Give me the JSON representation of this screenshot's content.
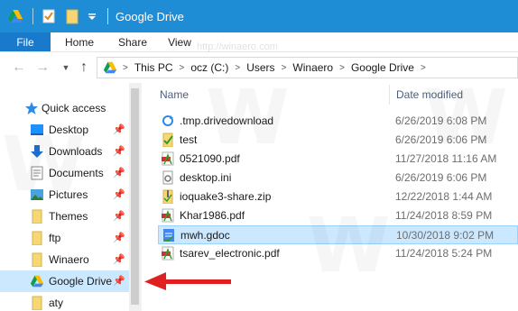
{
  "window": {
    "title": "Google Drive"
  },
  "ribbon": {
    "tabs": [
      "File",
      "Home",
      "Share",
      "View"
    ]
  },
  "address": {
    "crumbs": [
      "This PC",
      "ocz (C:)",
      "Users",
      "Winaero",
      "Google Drive"
    ],
    "watermark": "http://winaero.com"
  },
  "sidebar": {
    "items": [
      {
        "label": "Quick access",
        "icon": "star-icon",
        "pinned": false
      },
      {
        "label": "Desktop",
        "icon": "desktop-icon",
        "pinned": true
      },
      {
        "label": "Downloads",
        "icon": "download-arrow-icon",
        "pinned": true
      },
      {
        "label": "Documents",
        "icon": "documents-icon",
        "pinned": true
      },
      {
        "label": "Pictures",
        "icon": "pictures-icon",
        "pinned": true
      },
      {
        "label": "Themes",
        "icon": "folder-icon",
        "pinned": true
      },
      {
        "label": "ftp",
        "icon": "folder-icon",
        "pinned": true
      },
      {
        "label": "Winaero",
        "icon": "folder-icon",
        "pinned": true
      },
      {
        "label": "Google Drive",
        "icon": "google-drive-icon",
        "pinned": true,
        "selected": true
      },
      {
        "label": "aty",
        "icon": "folder-icon",
        "pinned": false
      }
    ]
  },
  "list": {
    "columns": {
      "name": "Name",
      "date": "Date modified"
    },
    "files": [
      {
        "name": ".tmp.drivedownload",
        "date": "6/26/2019 6:08 PM",
        "icon": "sync-folder-icon"
      },
      {
        "name": "test",
        "date": "6/26/2019 6:06 PM",
        "icon": "folder-check-icon"
      },
      {
        "name": "0521090.pdf",
        "date": "11/27/2018 11:16 AM",
        "icon": "pdf-icon"
      },
      {
        "name": "desktop.ini",
        "date": "6/26/2019 6:06 PM",
        "icon": "settings-file-icon"
      },
      {
        "name": "ioquake3-share.zip",
        "date": "12/22/2018 1:44 AM",
        "icon": "zip-icon"
      },
      {
        "name": "Khar1986.pdf",
        "date": "11/24/2018 8:59 PM",
        "icon": "pdf-icon"
      },
      {
        "name": "mwh.gdoc",
        "date": "10/30/2018 9:02 PM",
        "icon": "gdoc-icon",
        "selected": true
      },
      {
        "name": "tsarev_electronic.pdf",
        "date": "11/24/2018 5:24 PM",
        "icon": "pdf-icon"
      }
    ]
  },
  "colors": {
    "titlebar": "#1f8dd6",
    "file_tab": "#1979ca",
    "selection": "#cce8ff",
    "arrow": "#e02020"
  }
}
